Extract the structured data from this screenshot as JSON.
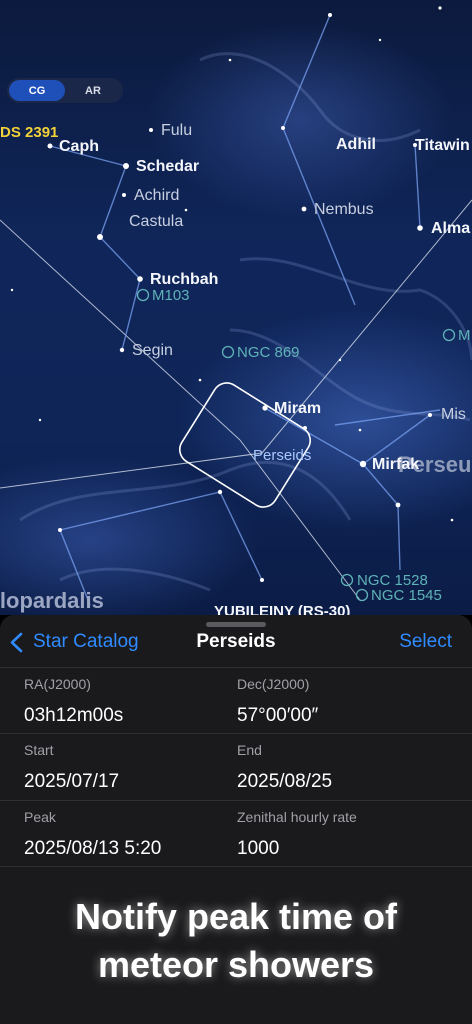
{
  "mode_toggle": {
    "options": [
      "CG",
      "AR"
    ],
    "selected": "CG"
  },
  "sky": {
    "labels": {
      "ds": "DS 2391",
      "caph": "Caph",
      "fulu": "Fulu",
      "schedar": "Schedar",
      "achird": "Achird",
      "castula": "Castula",
      "ruchbah": "Ruchbah",
      "m103": "M103",
      "segin": "Segin",
      "ngc869": "NGC 869",
      "adhil": "Adhil",
      "titawin": "Titawin",
      "nembus": "Nembus",
      "alma": "Alma",
      "m_right": "M",
      "miram": "Miram",
      "perseids": "Perseids",
      "mirfak": "Mirfak",
      "perseus": "Perseus",
      "mis": "Mis",
      "ngc1528": "NGC 1528",
      "ngc1545": "NGC 1545",
      "camelopardalis": "Camelopardalis",
      "yubileiny": "YUBILEINY (RS-30)"
    }
  },
  "sheet": {
    "back_label": "Star Catalog",
    "title": "Perseids",
    "select_label": "Select",
    "rows": [
      {
        "left": {
          "key": "RA(J2000)",
          "value": "03h12m00s"
        },
        "right": {
          "key": "Dec(J2000)",
          "value": "57°00′00″"
        }
      },
      {
        "left": {
          "key": "Start",
          "value": "2025/07/17"
        },
        "right": {
          "key": "End",
          "value": "2025/08/25"
        }
      },
      {
        "left": {
          "key": "Peak",
          "value": "2025/08/13 5:20"
        },
        "right": {
          "key": "Zenithal hourly rate",
          "value": "1000"
        }
      }
    ]
  },
  "caption": {
    "line1": "Notify peak time of",
    "line2": "meteor showers"
  }
}
